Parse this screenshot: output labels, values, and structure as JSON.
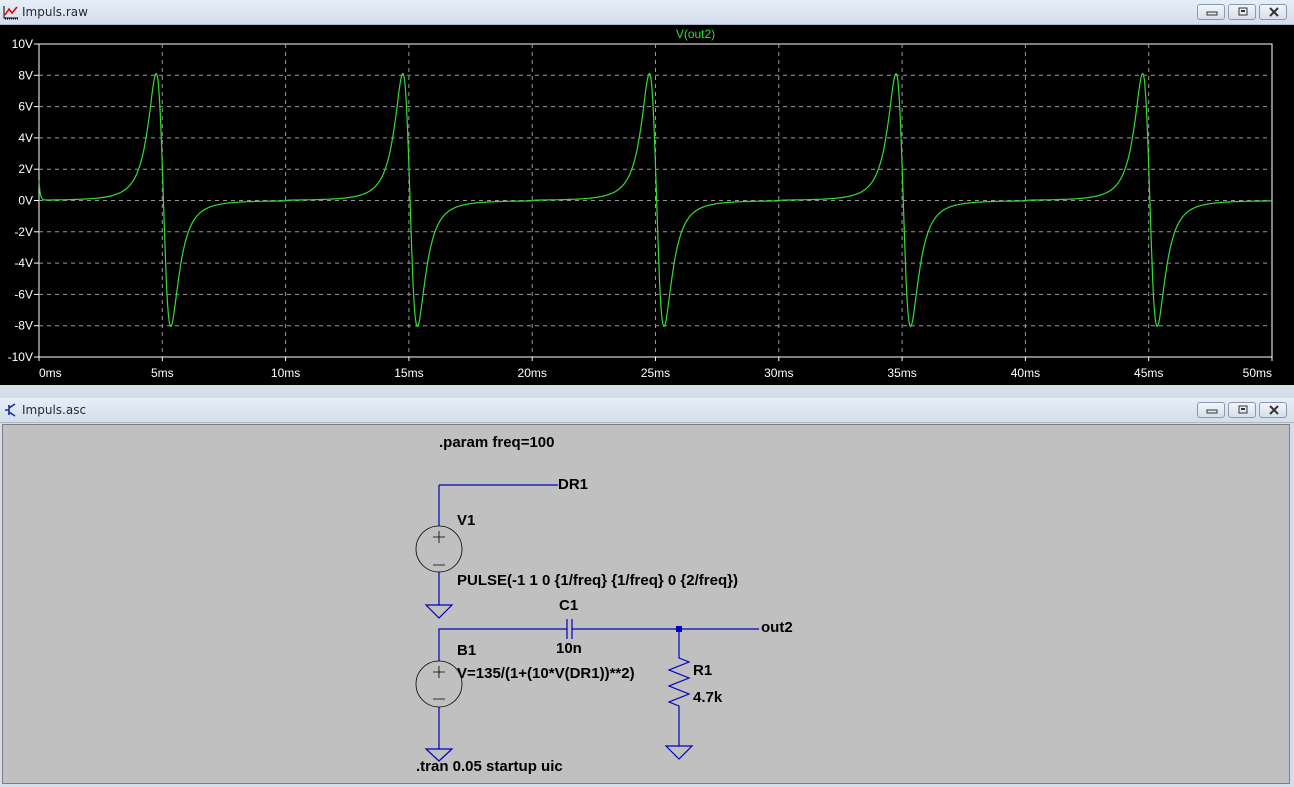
{
  "plot_window": {
    "title": "Impuls.raw",
    "icon": "waveform-icon"
  },
  "schematic_window": {
    "title": "Impuls.asc",
    "icon": "transistor-icon"
  },
  "window_buttons": {
    "minimize": "minimize-icon",
    "restore": "restore-icon",
    "close": "close-icon"
  },
  "colors": {
    "trace": "#33dd33",
    "plot_bg": "#000000",
    "schematic_bg": "#c0c0c0",
    "wire": "#0000c0",
    "grid": "#9a9a9a"
  },
  "chart_data": {
    "type": "line",
    "title": "V(out2)",
    "xlabel": "",
    "ylabel": "",
    "xlim": [
      0,
      50
    ],
    "ylim": [
      -10,
      10
    ],
    "x_unit": "ms",
    "x_ticks": [
      "0ms",
      "5ms",
      "10ms",
      "15ms",
      "20ms",
      "25ms",
      "30ms",
      "35ms",
      "40ms",
      "45ms",
      "50ms"
    ],
    "y_ticks": [
      "10V",
      "8V",
      "6V",
      "4V",
      "2V",
      "0V",
      "-2V",
      "-4V",
      "-6V",
      "-8V",
      "-10V"
    ],
    "grid": true,
    "series": [
      {
        "name": "V(out2)",
        "color": "#33dd33",
        "points": [
          [
            0,
            1.3
          ],
          [
            4.7,
            8.1
          ],
          [
            5.3,
            -8.0
          ],
          [
            14.7,
            8.1
          ],
          [
            15.3,
            -8.0
          ],
          [
            24.7,
            8.1
          ],
          [
            25.3,
            -8.0
          ],
          [
            34.7,
            8.1
          ],
          [
            35.3,
            -8.0
          ],
          [
            44.7,
            8.1
          ],
          [
            45.3,
            -8.0
          ],
          [
            50,
            0
          ]
        ],
        "model": {
          "period_ms": 20,
          "pulse_low": -1,
          "pulse_high": 1,
          "rise_ms": 10,
          "fall_ms": 10,
          "b_amplitude": 135,
          "b_gain": 10,
          "r_ohm": 4700,
          "c_farad": 1e-08
        }
      }
    ]
  },
  "schematic": {
    "param": ".param freq=100",
    "net_dr1": "DR1",
    "v1_name": "V1",
    "v1_value": "PULSE(-1 1 0 {1/freq} {1/freq} 0 {2/freq})",
    "c1_name": "C1",
    "c1_value": "10n",
    "net_out2": "out2",
    "b1_name": "B1",
    "b1_value": "V=135/(1+(10*V(DR1))**2)",
    "r1_name": "R1",
    "r1_value": "4.7k",
    "tran": ".tran 0.05 startup uic"
  }
}
